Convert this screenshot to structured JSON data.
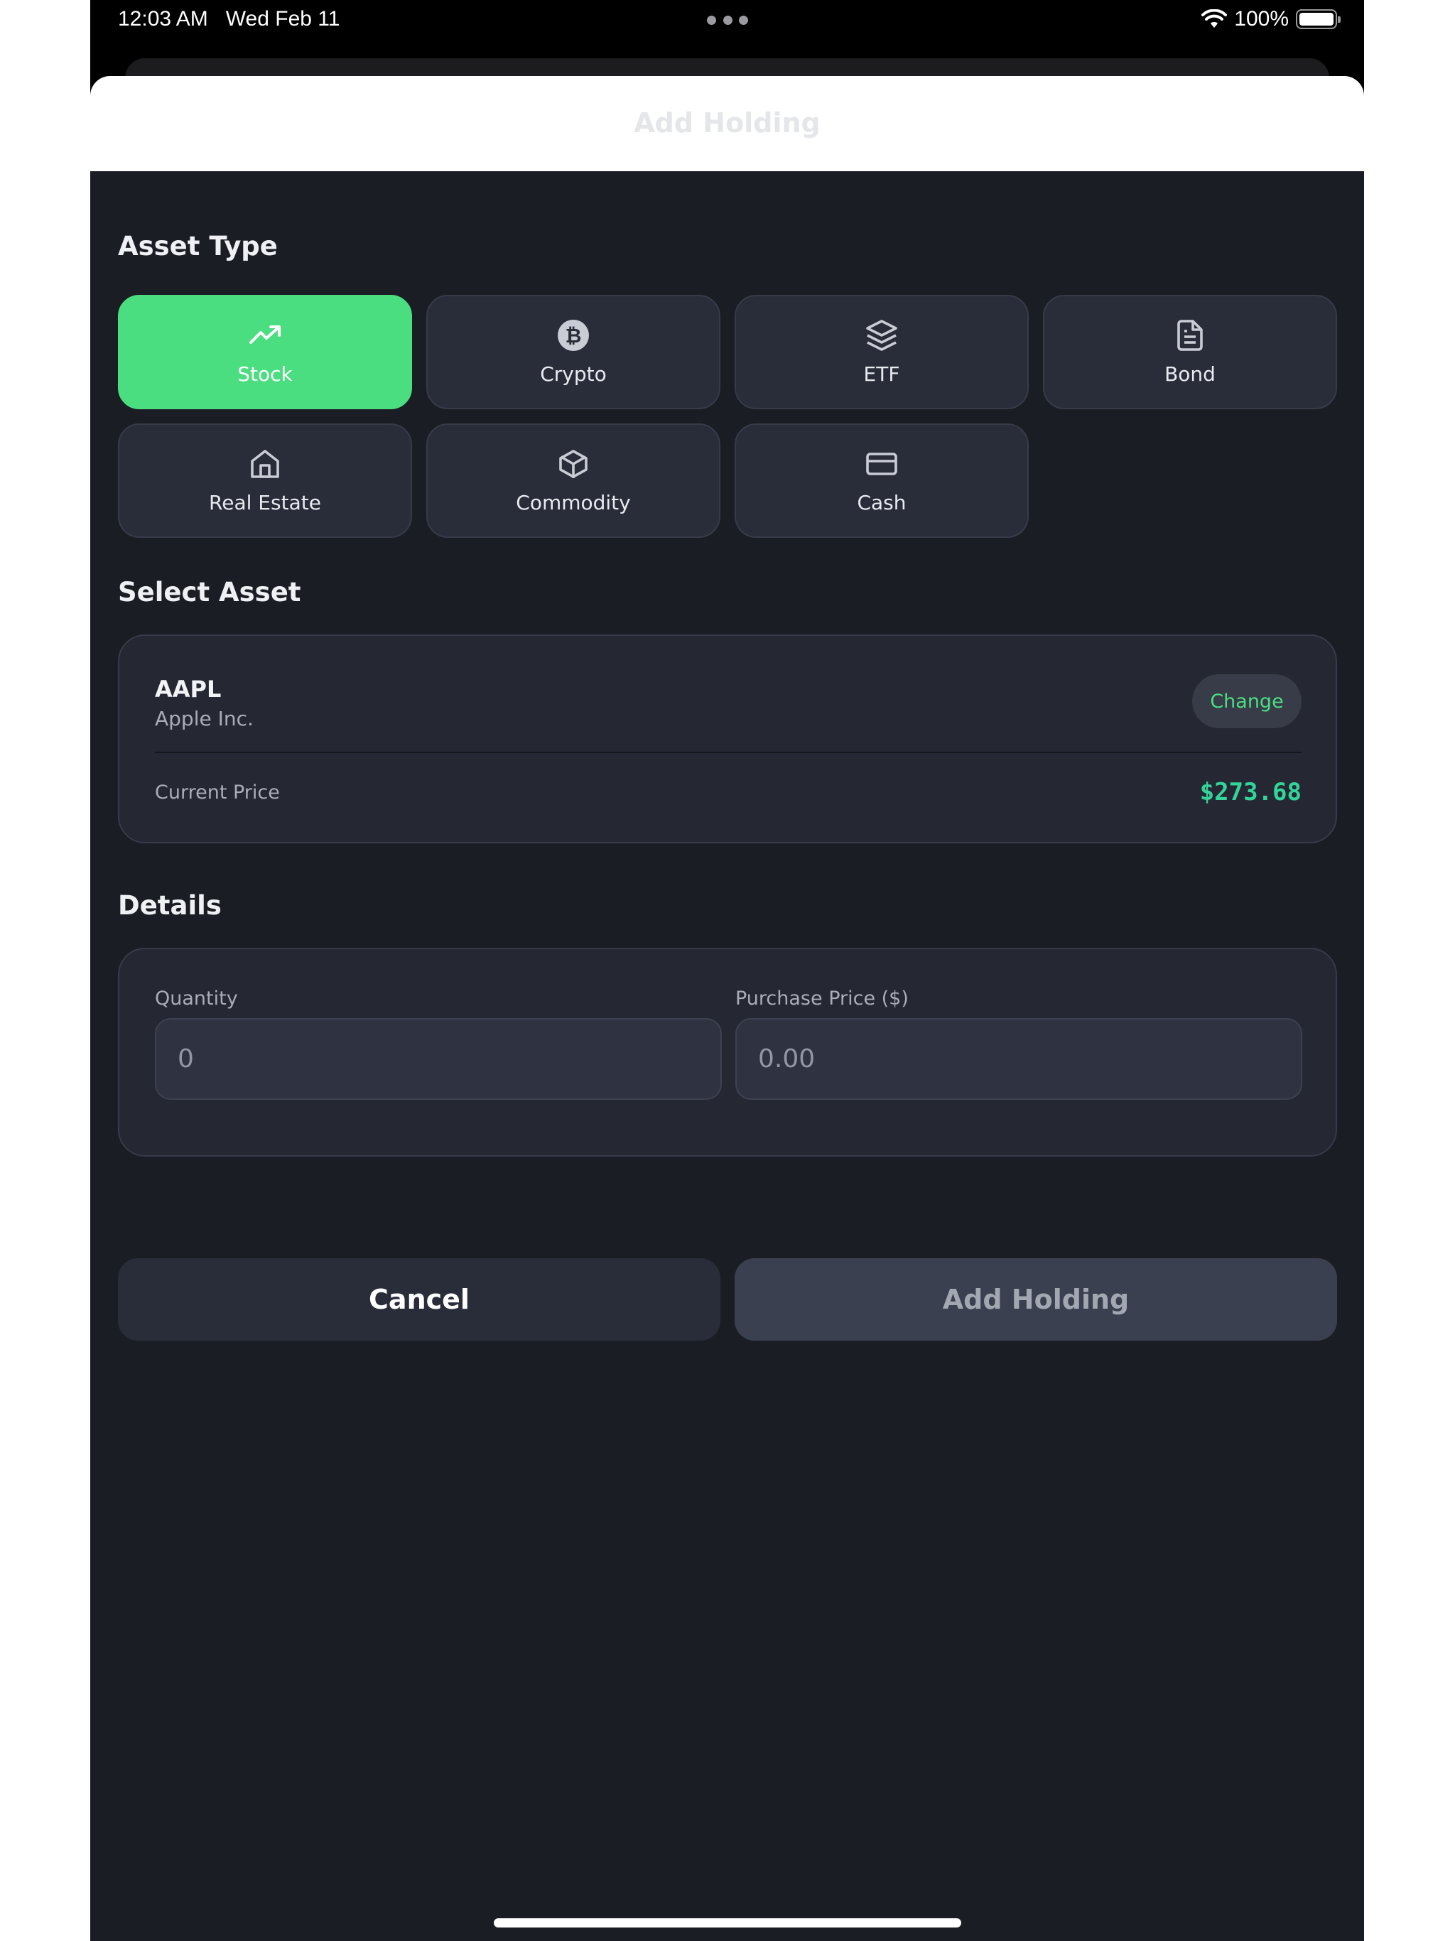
{
  "status_bar": {
    "time": "12:03 AM",
    "date": "Wed Feb 11",
    "battery": "100%",
    "icons": [
      "wifi-icon",
      "battery-icon",
      "multitasking-dots-icon"
    ]
  },
  "sheet": {
    "title": "Add Holding"
  },
  "asset_type": {
    "heading": "Asset Type",
    "options": [
      {
        "label": "Stock",
        "icon": "trending-up-icon",
        "selected": true
      },
      {
        "label": "Crypto",
        "icon": "bitcoin-icon",
        "selected": false
      },
      {
        "label": "ETF",
        "icon": "layers-icon",
        "selected": false
      },
      {
        "label": "Bond",
        "icon": "document-icon",
        "selected": false
      },
      {
        "label": "Real Estate",
        "icon": "home-icon",
        "selected": false
      },
      {
        "label": "Commodity",
        "icon": "box-icon",
        "selected": false
      },
      {
        "label": "Cash",
        "icon": "credit-card-icon",
        "selected": false
      }
    ]
  },
  "select_asset": {
    "heading": "Select Asset",
    "ticker": "AAPL",
    "name": "Apple Inc.",
    "change_label": "Change",
    "current_price_label": "Current Price",
    "current_price": "$273.68"
  },
  "details": {
    "heading": "Details",
    "quantity_label": "Quantity",
    "quantity_placeholder": "0",
    "purchase_price_label": "Purchase Price ($)",
    "purchase_price_placeholder": "0.00"
  },
  "actions": {
    "cancel_label": "Cancel",
    "add_label": "Add Holding"
  },
  "colors": {
    "accent": "#4ade80",
    "price": "#34d399",
    "background": "#1b1d24",
    "card": "#252833"
  }
}
